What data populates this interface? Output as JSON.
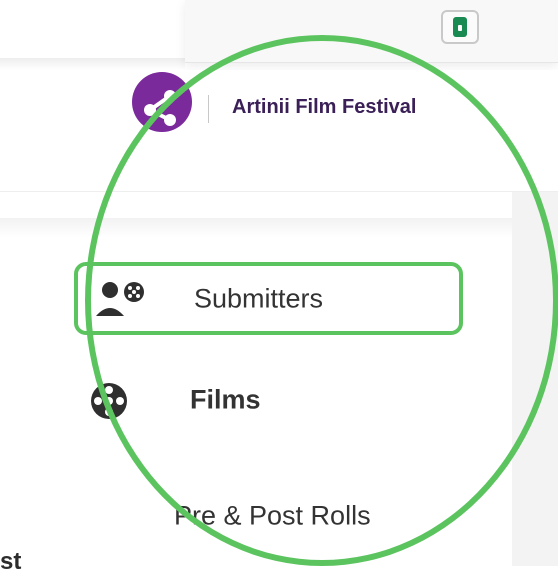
{
  "header": {
    "brand_title": "Artinii Film Festival"
  },
  "sidebar": {
    "items": [
      {
        "label": "Submitters",
        "icon": "user-reel-icon",
        "selected": true
      },
      {
        "label": "Films",
        "icon": "film-reel-icon",
        "selected": false
      },
      {
        "label": "Pre & Post Rolls",
        "icon": "",
        "selected": false
      }
    ],
    "partial_bottom_text": "st"
  },
  "colors": {
    "highlight_green": "#5cc45f",
    "brand_purple": "#7b2a9c",
    "text_dark": "#333333",
    "title_text": "#3b2057",
    "lock_green": "#188a52"
  },
  "icons": {
    "lock": "lock-icon",
    "brand": "share-network-icon"
  }
}
